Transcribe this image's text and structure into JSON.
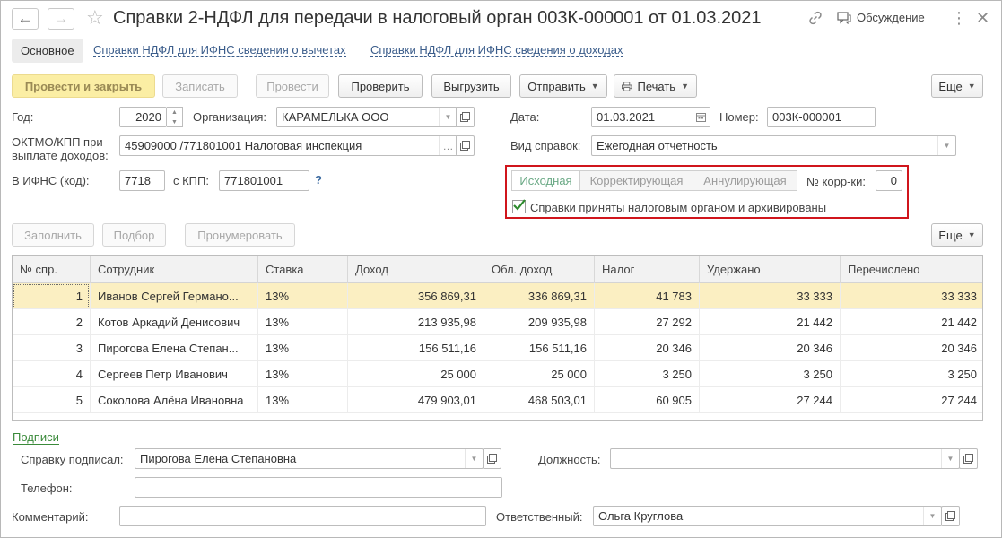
{
  "window": {
    "title": "Справки 2-НДФЛ для передачи в налоговый орган 003К-000001 от 01.03.2021",
    "discussion_label": "Обсуждение"
  },
  "tabs": [
    {
      "label": "Основное"
    },
    {
      "label": "Справки НДФЛ для ИФНС сведения о вычетах"
    },
    {
      "label": "Справки НДФЛ для ИФНС сведения о доходах"
    }
  ],
  "toolbar": {
    "post_close": "Провести и закрыть",
    "save": "Записать",
    "post": "Провести",
    "check": "Проверить",
    "export": "Выгрузить",
    "send": "Отправить",
    "print": "Печать",
    "more": "Еще"
  },
  "form": {
    "year_label": "Год:",
    "year_value": "2020",
    "org_label": "Организация:",
    "org_value": "КАРАМЕЛЬКА ООО",
    "date_label": "Дата:",
    "date_value": "01.03.2021",
    "number_label": "Номер:",
    "number_value": "003К-000001",
    "oktmo_label_line1": "ОКТМО/КПП при",
    "oktmo_label_line2": "выплате доходов:",
    "oktmo_value": "45909000   /771801001 Налоговая инспекция",
    "kind_label": "Вид справок:",
    "kind_value": "Ежегодная отчетность",
    "ifns_label": "В ИФНС (код):",
    "ifns_value": "7718",
    "kpp_label": "с КПП:",
    "kpp_value": "771801001",
    "help": "?"
  },
  "kind_group": {
    "segments": [
      "Исходная",
      "Корректирующая",
      "Аннулирующая"
    ],
    "corr_label": "№ корр-ки:",
    "corr_value": "0",
    "accepted_label": "Справки приняты налоговым органом и архивированы",
    "accepted_checked": true
  },
  "table_toolbar": {
    "fill": "Заполнить",
    "select": "Подбор",
    "renumber": "Пронумеровать",
    "more": "Еще"
  },
  "table": {
    "columns": [
      "№ спр.",
      "Сотрудник",
      "Ставка",
      "Доход",
      "Обл. доход",
      "Налог",
      "Удержано",
      "Перечислено"
    ],
    "rows": [
      {
        "n": "1",
        "employee": "Иванов Сергей Германо...",
        "rate": "13%",
        "income": "356 869,31",
        "taxable": "336 869,31",
        "tax": "41 783",
        "withheld": "33 333",
        "transferred": "33 333"
      },
      {
        "n": "2",
        "employee": "Котов Аркадий Денисович",
        "rate": "13%",
        "income": "213 935,98",
        "taxable": "209 935,98",
        "tax": "27 292",
        "withheld": "21 442",
        "transferred": "21 442"
      },
      {
        "n": "3",
        "employee": "Пирогова Елена Степан...",
        "rate": "13%",
        "income": "156 511,16",
        "taxable": "156 511,16",
        "tax": "20 346",
        "withheld": "20 346",
        "transferred": "20 346"
      },
      {
        "n": "4",
        "employee": "Сергеев Петр Иванович",
        "rate": "13%",
        "income": "25 000",
        "taxable": "25 000",
        "tax": "3 250",
        "withheld": "3 250",
        "transferred": "3 250"
      },
      {
        "n": "5",
        "employee": "Соколова Алёна Ивановна",
        "rate": "13%",
        "income": "479 903,01",
        "taxable": "468 503,01",
        "tax": "60 905",
        "withheld": "27 244",
        "transferred": "27 244"
      }
    ]
  },
  "signatures": {
    "section_link": "Подписи",
    "signed_label": "Справку подписал:",
    "signed_value": "Пирогова Елена Степановна",
    "position_label": "Должность:",
    "position_value": "",
    "phone_label": "Телефон:",
    "phone_value": "",
    "comment_label": "Комментарий:",
    "comment_value": "",
    "responsible_label": "Ответственный:",
    "responsible_value": "Ольга Круглова"
  },
  "colors": {
    "accent_yellow": "#f8e27a",
    "link_blue": "#3b5d8b",
    "highlight_red": "#d0151c",
    "selected_row": "#fbefc2",
    "check_green": "#2e8b2e"
  }
}
